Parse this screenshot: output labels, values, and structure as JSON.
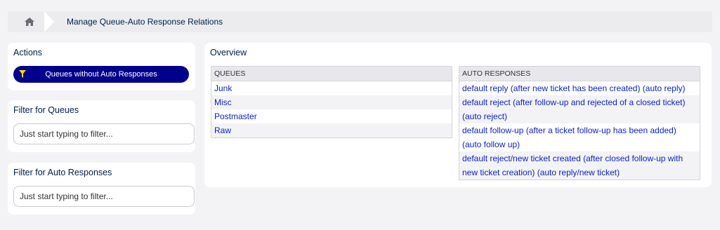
{
  "breadcrumb": {
    "home_icon": "home-icon",
    "current": "Manage Queue-Auto Response Relations"
  },
  "actions": {
    "title": "Actions",
    "button_label": "Queues without Auto Responses",
    "button_icon": "filter-icon"
  },
  "filter_queues": {
    "title": "Filter for Queues",
    "placeholder": "Just start typing to filter..."
  },
  "filter_auto_responses": {
    "title": "Filter for Auto Responses",
    "placeholder": "Just start typing to filter..."
  },
  "overview": {
    "title": "Overview",
    "queues_header": "QUEUES",
    "queues": [
      "Junk",
      "Misc",
      "Postmaster",
      "Raw"
    ],
    "auto_responses_header": "AUTO RESPONSES",
    "auto_responses": [
      "default reply (after new ticket has been created) (auto reply)",
      "default reject (after follow-up and rejected of a closed ticket)",
      "(auto reject)",
      "default follow-up (after a ticket follow-up has been added)",
      "(auto follow up)",
      "default reject/new ticket created (after closed follow-up with",
      "new ticket creation) (auto reply/new ticket)"
    ]
  },
  "colors": {
    "accent": "#00008b",
    "link": "#0b21c9",
    "text": "#001b4d",
    "background": "#f3f3f5"
  }
}
